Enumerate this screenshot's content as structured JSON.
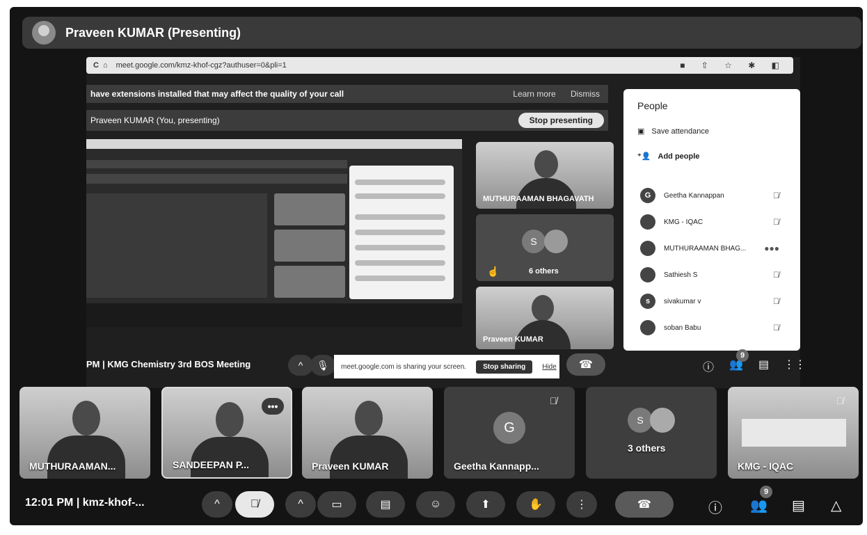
{
  "presenter_bar": {
    "title": "Praveen KUMAR (Presenting)"
  },
  "browser": {
    "url": "meet.google.com/kmz-khof-cgz?authuser=0&pli=1"
  },
  "extension_warning": {
    "text": "have extensions installed that may affect the quality of your call",
    "learn_more": "Learn more",
    "dismiss": "Dismiss"
  },
  "presenting_row": {
    "label": "Praveen KUMAR (You, presenting)",
    "stop_label": "Stop presenting"
  },
  "side_tiles": [
    {
      "name": "MUTHURAAMAN BHAGAVATH"
    },
    {
      "name": "6 others",
      "initial": "S"
    },
    {
      "name": "Praveen KUMAR"
    }
  ],
  "people_panel": {
    "title": "People",
    "save_attendance": "Save attendance",
    "add_people": "Add people",
    "people": [
      {
        "initial": "G",
        "name": "Geetha Kannappan"
      },
      {
        "initial": "",
        "name": "KMG - IQAC"
      },
      {
        "initial": "",
        "name": "MUTHURAAMAN BHAG..."
      },
      {
        "initial": "",
        "name": "Sathiesh S"
      },
      {
        "initial": "s",
        "name": "sivakumar v"
      },
      {
        "initial": "",
        "name": "soban Babu"
      }
    ]
  },
  "stage_toolbar": {
    "meeting": "PM  |  KMG Chemistry 3rd BOS Meeting",
    "share_text": "meet.google.com is sharing your screen.",
    "stop_sharing": "Stop sharing",
    "hide": "Hide",
    "people_count": "9"
  },
  "strip_tiles": [
    {
      "name": "MUTHURAAMAN..."
    },
    {
      "name": "SANDEEPAN P..."
    },
    {
      "name": "Praveen KUMAR"
    },
    {
      "name": "Geetha Kannapp...",
      "initial": "G"
    },
    {
      "name": "3 others",
      "initial": "S"
    },
    {
      "name": "KMG - IQAC"
    }
  ],
  "bottom_bar": {
    "clock": "12:01 PM  |  kmz-khof-...",
    "people_count": "9"
  },
  "colors": {
    "background": "#141414",
    "panel": "#ffffff",
    "tile": "#3e3e3e"
  }
}
